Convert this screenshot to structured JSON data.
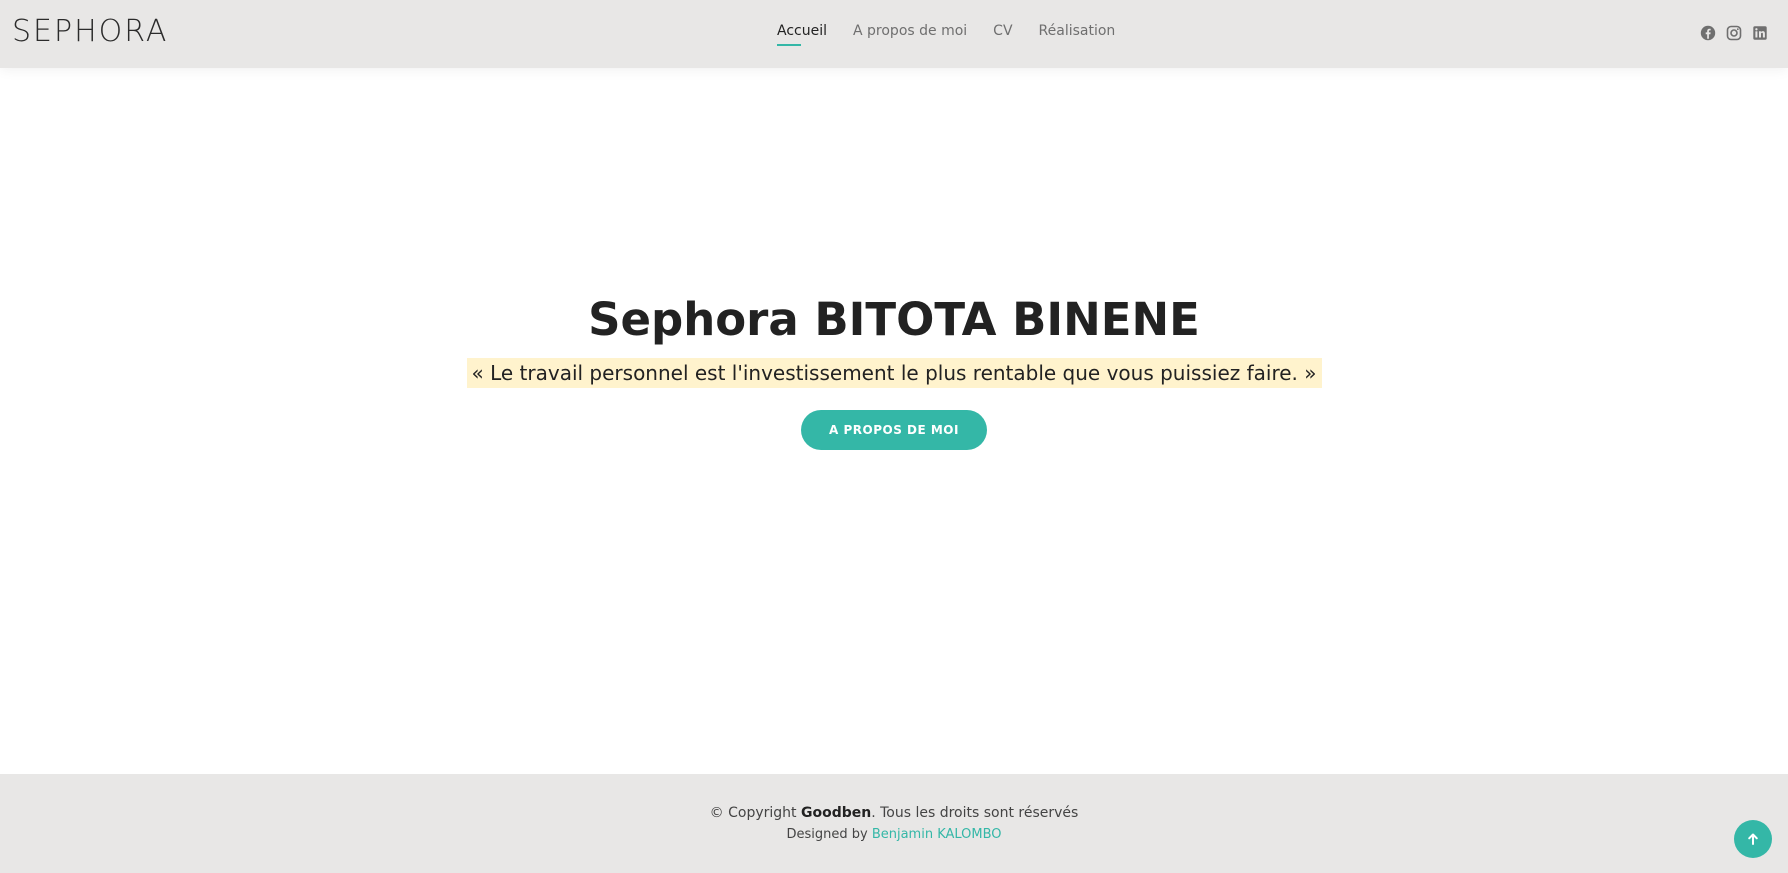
{
  "header": {
    "logo": "SEPHORA",
    "nav": [
      {
        "label": "Accueil",
        "active": true
      },
      {
        "label": "A propos de moi",
        "active": false
      },
      {
        "label": "CV",
        "active": false
      },
      {
        "label": "Réalisation",
        "active": false
      }
    ],
    "social_icons": [
      "facebook-icon",
      "instagram-icon",
      "linkedin-icon"
    ]
  },
  "hero": {
    "title": "Sephora BITOTA BINENE",
    "quote": "« Le travail personnel est l'investissement le plus rentable que vous puissiez faire. »",
    "button_label": "A PROPOS DE MOI"
  },
  "footer": {
    "copyright_prefix": "© Copyright ",
    "brand": "Goodben",
    "copyright_suffix": ". Tous les droits sont réservés",
    "designed_by": "Designed by ",
    "designer": "Benjamin KALOMBO"
  },
  "colors": {
    "accent": "#34b7a7",
    "header_background": "#e8e7e6",
    "footer_background": "#e8e7e6",
    "quote_highlight": "#fff3cd"
  }
}
